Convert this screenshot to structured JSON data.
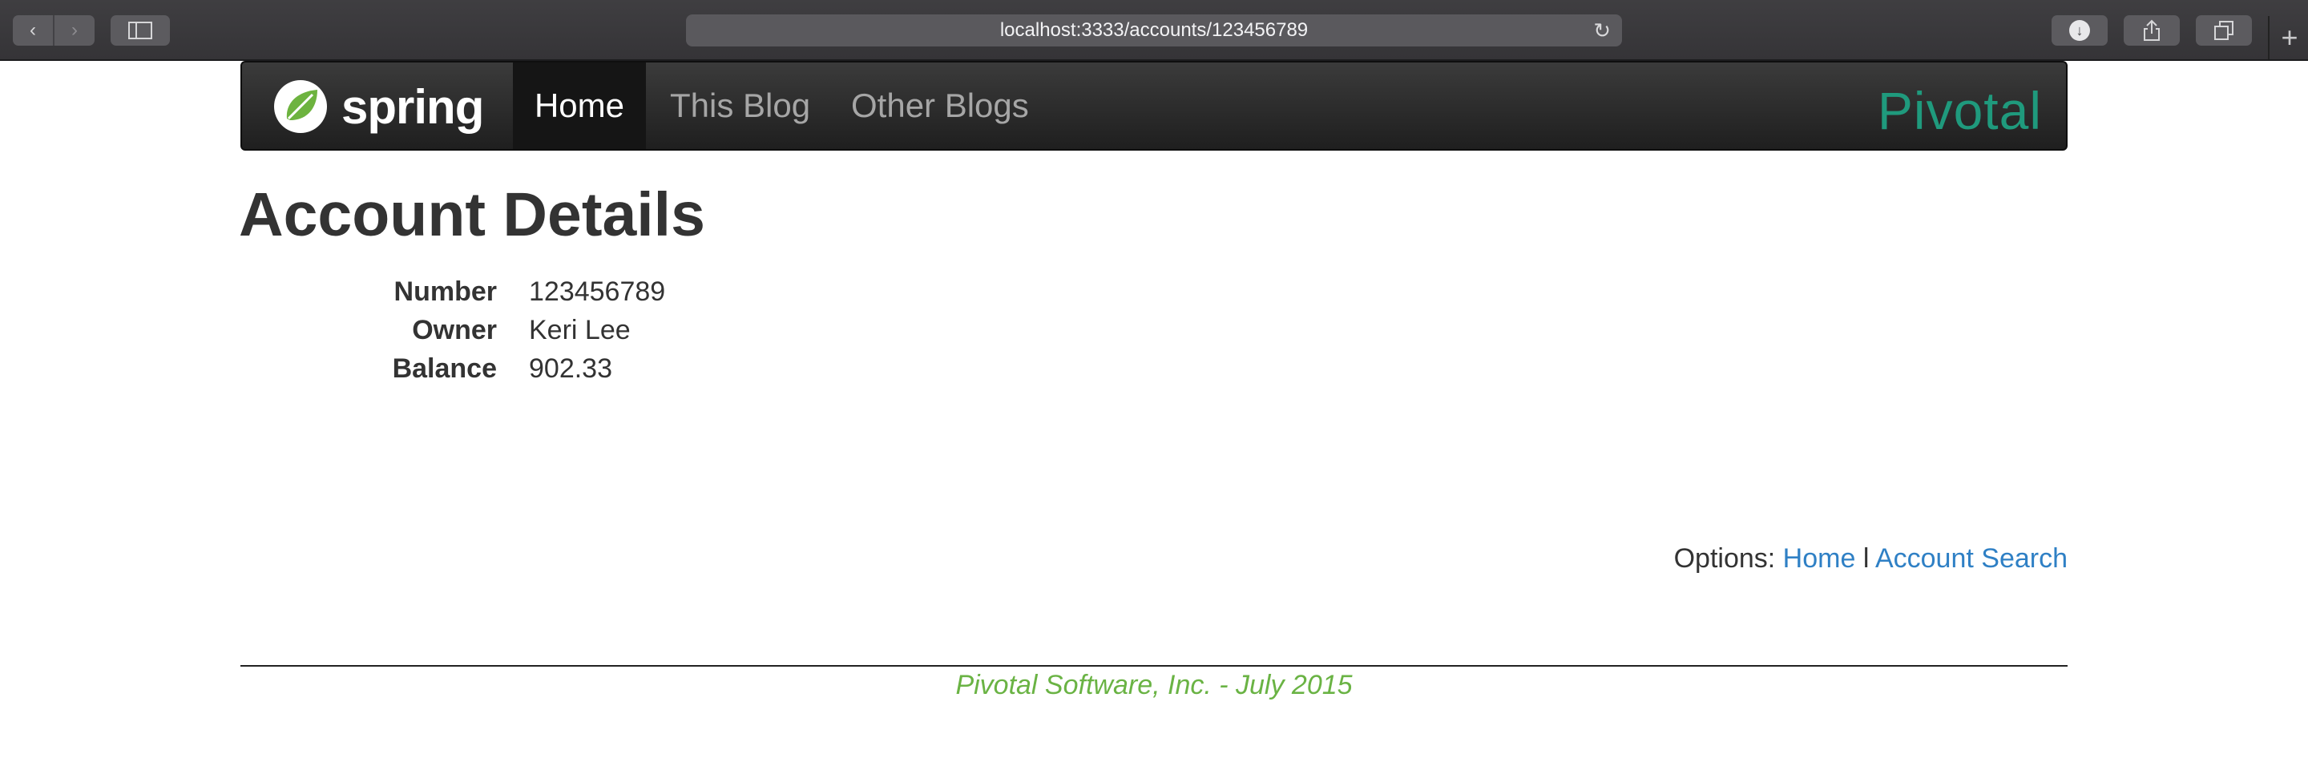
{
  "browser": {
    "url": "localhost:3333/accounts/123456789",
    "back_icon": "‹",
    "forward_icon": "›",
    "reload_icon": "↻",
    "new_tab_icon": "+"
  },
  "navbar": {
    "brand": "spring",
    "items": [
      {
        "label": "Home",
        "active": true
      },
      {
        "label": "This Blog",
        "active": false
      },
      {
        "label": "Other Blogs",
        "active": false
      }
    ],
    "partner_logo": "Pivotal"
  },
  "page": {
    "title": "Account Details",
    "details": [
      {
        "label": "Number",
        "value": "123456789"
      },
      {
        "label": "Owner",
        "value": "Keri Lee"
      },
      {
        "label": "Balance",
        "value": "902.33"
      }
    ],
    "options_label": "Options:",
    "options_links": [
      {
        "label": "Home"
      },
      {
        "label": "Account Search"
      }
    ],
    "options_separator": "l"
  },
  "footer": {
    "text": "Pivotal Software, Inc. - July 2015"
  },
  "colors": {
    "link": "#2f80c5",
    "footer": "#6ab344",
    "pivotal": "#1f9a7d",
    "spring_green": "#6db33f"
  }
}
